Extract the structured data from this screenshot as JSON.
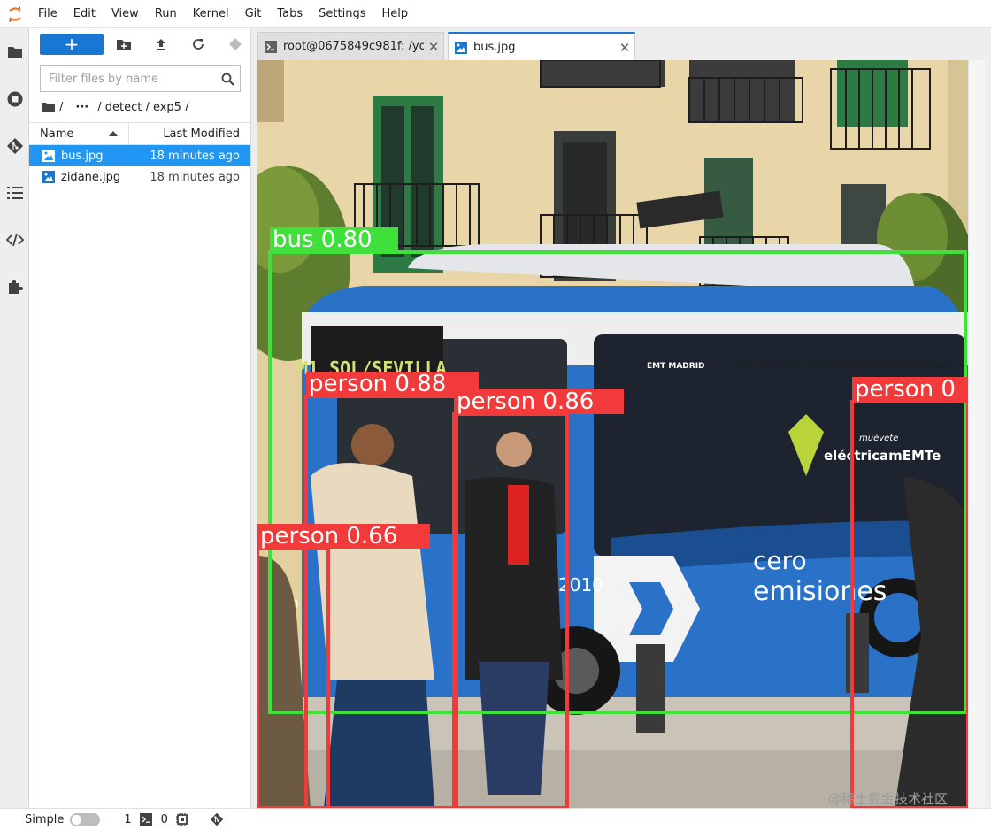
{
  "menu": [
    "File",
    "Edit",
    "View",
    "Run",
    "Kernel",
    "Git",
    "Tabs",
    "Settings",
    "Help"
  ],
  "activity_bar": [
    "folder-icon",
    "running-icon",
    "git-icon",
    "toc-icon",
    "property-inspector-icon",
    "extensions-icon"
  ],
  "file_browser": {
    "new_label": "+",
    "filter_placeholder": "Filter files by name",
    "breadcrumb": {
      "root": "/",
      "ellipsis": "···",
      "path": "/ detect / exp5 /"
    },
    "columns": {
      "name": "Name",
      "modified": "Last Modified"
    },
    "files": [
      {
        "name": "bus.jpg",
        "modified": "18 minutes ago",
        "selected": true
      },
      {
        "name": "zidane.jpg",
        "modified": "18 minutes ago",
        "selected": false
      }
    ]
  },
  "tabs": [
    {
      "label": "root@0675849c981f: /yolov5",
      "active": false
    },
    {
      "label": "bus.jpg",
      "active": true
    }
  ],
  "image": {
    "signage": {
      "route": "M1 SOL/SEVILLA",
      "side_banner": "Un minibús 100% eléctrico si es plan",
      "operator": "EMT MADRID",
      "brand_top": "muévete",
      "brand": "eléctricamEMTe",
      "slogan_1": "cero",
      "slogan_2": "emisiones",
      "bus_number": "2010",
      "rear_plate": "010"
    },
    "detections": [
      {
        "label": "bus 0.80",
        "class": "bus"
      },
      {
        "label": "person 0.88",
        "class": "person"
      },
      {
        "label": "person 0.86",
        "class": "person"
      },
      {
        "label": "person 0",
        "class": "person"
      },
      {
        "label": "person 0.66",
        "class": "person"
      }
    ]
  },
  "status": {
    "mode_label": "Simple",
    "terminals": "1",
    "kernels": "0"
  },
  "watermark": "@稀土掘金技术社区",
  "colors": {
    "accent": "#1976d2",
    "selection": "#2196f3",
    "bus_box": "#3fe03a",
    "person_box": "#f23a3a",
    "bus_body": "#2a72c8"
  }
}
